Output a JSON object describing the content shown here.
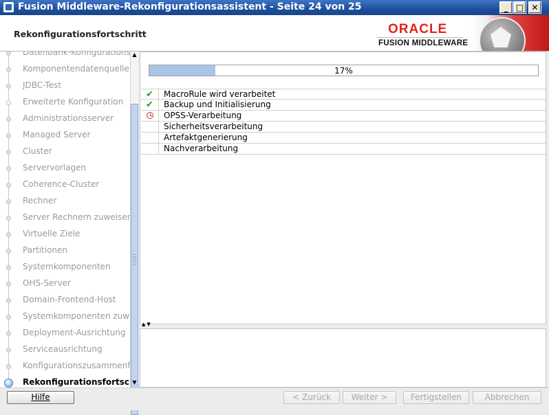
{
  "window": {
    "title": "Fusion Middleware-Rekonfigurationsassistent - Seite 24 von 25",
    "minimize_glyph": "_",
    "maximize_glyph": "□",
    "close_glyph": "✕"
  },
  "header": {
    "step_title": "Rekonfigurationsfortschritt",
    "logo_line1": "ORACLE",
    "logo_line2": "FUSION MIDDLEWARE"
  },
  "nav": {
    "items": [
      {
        "label": "Datenbank-Konfigurationstyp",
        "state": "done"
      },
      {
        "label": "Komponentendatenquellen",
        "state": "done"
      },
      {
        "label": "JDBC-Test",
        "state": "done"
      },
      {
        "label": "Erweiterte Konfiguration",
        "state": "branch"
      },
      {
        "label": "Administrationsserver",
        "state": "done"
      },
      {
        "label": "Managed Server",
        "state": "done"
      },
      {
        "label": "Cluster",
        "state": "done"
      },
      {
        "label": "Servervorlagen",
        "state": "done"
      },
      {
        "label": "Coherence-Cluster",
        "state": "done"
      },
      {
        "label": "Rechner",
        "state": "done"
      },
      {
        "label": "Server Rechnern zuweisen",
        "state": "done"
      },
      {
        "label": "Virtuelle Ziele",
        "state": "done"
      },
      {
        "label": "Partitionen",
        "state": "done"
      },
      {
        "label": "Systemkomponenten",
        "state": "done"
      },
      {
        "label": "OHS-Server",
        "state": "done"
      },
      {
        "label": "Domain-Frontend-Host",
        "state": "done"
      },
      {
        "label": "Systemkomponenten zuweisen",
        "state": "done"
      },
      {
        "label": "Deployment-Ausrichtung",
        "state": "done"
      },
      {
        "label": "Serviceausrichtung",
        "state": "done"
      },
      {
        "label": "Konfigurationszusammenfassung",
        "state": "done"
      },
      {
        "label": "Rekonfigurationsfortschritt",
        "state": "current"
      }
    ]
  },
  "progress": {
    "percent_label": "17%",
    "fraction": 0.17
  },
  "tasks": [
    {
      "label": "MacroRule wird verarbeitet",
      "status": "done",
      "icon": "check-icon"
    },
    {
      "label": "Backup und Initialisierung",
      "status": "done",
      "icon": "check-icon"
    },
    {
      "label": "OPSS-Verarbeitung",
      "status": "running",
      "icon": "clock-icon"
    },
    {
      "label": "Sicherheitsverarbeitung",
      "status": "pending",
      "icon": ""
    },
    {
      "label": "Artefaktgenerierung",
      "status": "pending",
      "icon": ""
    },
    {
      "label": "Nachverarbeitung",
      "status": "pending",
      "icon": ""
    }
  ],
  "footer": {
    "help": "Hilfe",
    "back": "< Zurück",
    "next": "Weiter >",
    "finish": "Fertigstellen",
    "cancel": "Abbrechen"
  },
  "colors": {
    "titlebar": "#1e4f9e",
    "oracle_red": "#e2231a",
    "progress_fill": "#a9c4e6",
    "check": "#2a9a2a"
  }
}
